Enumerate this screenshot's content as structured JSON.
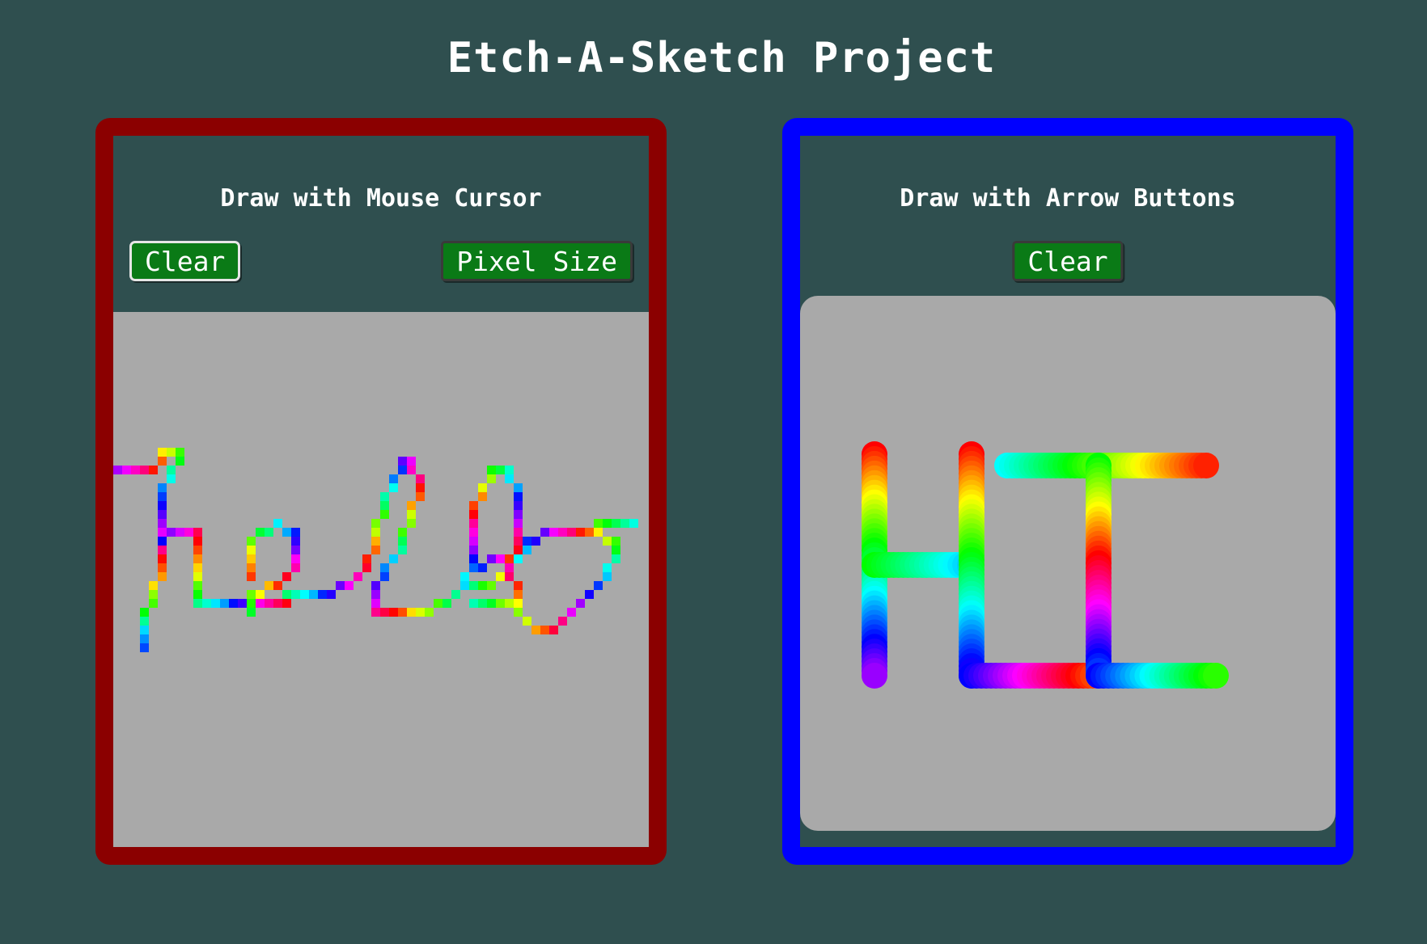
{
  "page": {
    "title": "Etch-A-Sketch Project"
  },
  "mouse_panel": {
    "title": "Draw with Mouse Cursor",
    "clear_label": "Clear",
    "pixel_size_label": "Pixel Size",
    "border_color": "#8b0000",
    "canvas_color": "#a9a9a9",
    "drawn_text": "hello"
  },
  "arrow_panel": {
    "title": "Draw with Arrow Buttons",
    "clear_label": "Clear",
    "border_color": "#0000ff",
    "canvas_color": "#a9a9a9",
    "drawn_text": "HI"
  },
  "colors": {
    "background": "#2f4f4f",
    "button": "#0a7a16"
  }
}
